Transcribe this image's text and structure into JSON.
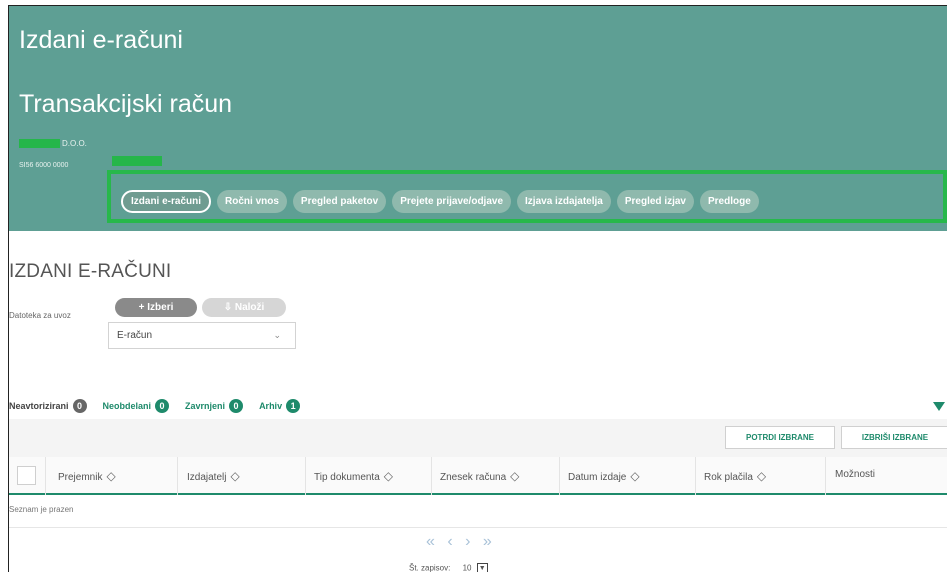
{
  "header": {
    "title": "Izdani e-računi",
    "subtitle": "Transakcijski račun",
    "company_suffix": "D.O.O.",
    "iban": "SI56 6000 0000"
  },
  "tabs": [
    {
      "label": "Izdani e-računi",
      "active": true
    },
    {
      "label": "Ročni vnos",
      "active": false
    },
    {
      "label": "Pregled paketov",
      "active": false
    },
    {
      "label": "Prejete prijave/odjave",
      "active": false
    },
    {
      "label": "Izjava izdajatelja",
      "active": false
    },
    {
      "label": "Pregled izjav",
      "active": false
    },
    {
      "label": "Predloge",
      "active": false
    }
  ],
  "section": {
    "title": "IZDANI E-RAČUNI",
    "select_button": "+ Izberi",
    "upload_button": "⇩ Naloži",
    "import_label": "Datoteka za uvoz",
    "doc_type_value": "E-račun",
    "chevron": "⌄"
  },
  "filters": [
    {
      "label": "Neavtorizirani",
      "count": "0",
      "active": false
    },
    {
      "label": "Neobdelani",
      "count": "0",
      "active": true
    },
    {
      "label": "Zavrnjeni",
      "count": "0",
      "active": true
    },
    {
      "label": "Arhiv",
      "count": "1",
      "active": true
    }
  ],
  "actions": {
    "confirm": "POTRDI IZBRANE",
    "delete": "IZBRIŠI IZBRANE"
  },
  "table": {
    "columns": [
      "Prejemnik",
      "Izdajatelj",
      "Tip dokumenta",
      "Znesek računa",
      "Datum izdaje",
      "Rok plačila",
      "Možnosti"
    ],
    "sort_icon": "◇",
    "empty_text": "Seznam je prazen"
  },
  "pagination": {
    "arrows": "« ‹ › »",
    "records_label": "Št. zapisov:",
    "records_value": "10"
  },
  "colors": {
    "header_bg": "#5e9f94",
    "accent": "#1e8a6b",
    "highlight": "#27b84b"
  }
}
